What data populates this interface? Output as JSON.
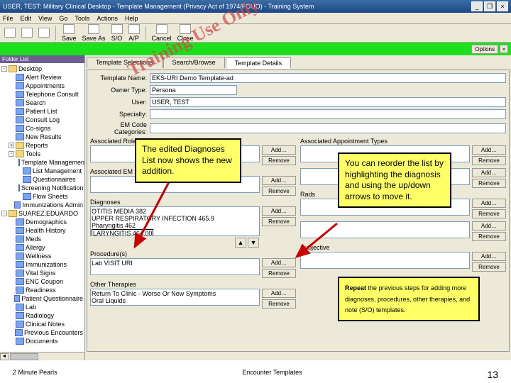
{
  "title": "USER, TEST: Military Clinical Desktop - Template Management (Privacy Act of 1974/FOUO) - Training System",
  "menu": [
    "File",
    "Edit",
    "View",
    "Go",
    "Tools",
    "Actions",
    "Help"
  ],
  "toolbar_btns": [
    {
      "ic": "new",
      "label": ""
    },
    {
      "ic": "open",
      "label": ""
    },
    {
      "ic": "save",
      "label": ""
    },
    {
      "ic": "sep"
    },
    {
      "ic": "save",
      "label": "Save"
    },
    {
      "ic": "saveas",
      "label": "Save As"
    },
    {
      "ic": "so",
      "label": "S/O"
    },
    {
      "ic": "ap",
      "label": "A/P"
    },
    {
      "ic": "sep"
    },
    {
      "ic": "cancel",
      "label": "Cancel"
    },
    {
      "ic": "close",
      "label": "Close"
    }
  ],
  "greenbar": {
    "options": "Options",
    "close": "×"
  },
  "sidebar": {
    "header": "Folder List",
    "nodes": [
      {
        "t": "Desktop",
        "tg": "-",
        "lvl": 0
      },
      {
        "t": "Alert Review",
        "tg": "",
        "lvl": 1,
        "ci": 1
      },
      {
        "t": "Appointments",
        "tg": "",
        "lvl": 1,
        "ci": 1
      },
      {
        "t": "Telephone Consult",
        "tg": "",
        "lvl": 1,
        "ci": 1
      },
      {
        "t": "Search",
        "tg": "",
        "lvl": 1,
        "ci": 1
      },
      {
        "t": "Patient List",
        "tg": "",
        "lvl": 1,
        "ci": 1
      },
      {
        "t": "Consult Log",
        "tg": "",
        "lvl": 1,
        "ci": 1
      },
      {
        "t": "Co-signs",
        "tg": "",
        "lvl": 1,
        "ci": 1
      },
      {
        "t": "New Results",
        "tg": "",
        "lvl": 1,
        "ci": 1
      },
      {
        "t": "Reports",
        "tg": "+",
        "lvl": 1
      },
      {
        "t": "Tools",
        "tg": "-",
        "lvl": 1
      },
      {
        "t": "Template Management",
        "tg": "",
        "lvl": 2,
        "ci": 1
      },
      {
        "t": "List Management",
        "tg": "",
        "lvl": 2,
        "ci": 1
      },
      {
        "t": "Questionnaires",
        "tg": "",
        "lvl": 2,
        "ci": 1
      },
      {
        "t": "Screening Notification",
        "tg": "",
        "lvl": 2,
        "ci": 1
      },
      {
        "t": "Flow Sheets",
        "tg": "",
        "lvl": 2,
        "ci": 1
      },
      {
        "t": "Immunizations Admin",
        "tg": "",
        "lvl": 1,
        "ci": 1
      },
      {
        "t": "SUAREZ,EDUARDO",
        "tg": "-",
        "lvl": 0
      },
      {
        "t": "Demographics",
        "tg": "",
        "lvl": 1,
        "ci": 1
      },
      {
        "t": "Health History",
        "tg": "",
        "lvl": 1,
        "ci": 1
      },
      {
        "t": "Meds",
        "tg": "",
        "lvl": 1,
        "ci": 1
      },
      {
        "t": "Allergy",
        "tg": "",
        "lvl": 1,
        "ci": 1
      },
      {
        "t": "Wellness",
        "tg": "",
        "lvl": 1,
        "ci": 1
      },
      {
        "t": "Immunizations",
        "tg": "",
        "lvl": 1,
        "ci": 1
      },
      {
        "t": "Vital Signs",
        "tg": "",
        "lvl": 1,
        "ci": 1
      },
      {
        "t": "ENC Coupon",
        "tg": "",
        "lvl": 1,
        "ci": 1
      },
      {
        "t": "Readiness",
        "tg": "",
        "lvl": 1,
        "ci": 1
      },
      {
        "t": "Patient Questionnaire",
        "tg": "",
        "lvl": 1,
        "ci": 1
      },
      {
        "t": "Lab",
        "tg": "",
        "lvl": 1,
        "ci": 1
      },
      {
        "t": "Radiology",
        "tg": "",
        "lvl": 1,
        "ci": 1
      },
      {
        "t": "Clinical Notes",
        "tg": "",
        "lvl": 1,
        "ci": 1
      },
      {
        "t": "Previous Encounters",
        "tg": "",
        "lvl": 1,
        "ci": 1
      },
      {
        "t": "Documents",
        "tg": "",
        "lvl": 1,
        "ci": 1
      }
    ]
  },
  "tabs": [
    "Template Selections",
    "Search/Browse",
    "Template Details"
  ],
  "active_tab": 2,
  "form": {
    "template_name_lbl": "Template Name:",
    "template_name": "EKS-URI Demo Template-ad",
    "owner_type_lbl": "Owner Type:",
    "owner_type": "Persona",
    "user_lbl": "User:",
    "user": "USER, TEST",
    "specialty_lbl": "Specialty:",
    "specialty": "",
    "em_lbl": "EM Code Categories:",
    "em": ""
  },
  "left_groups": [
    {
      "h": "Associated Roles",
      "items": [],
      "tall": 0
    },
    {
      "h": "Associated EM",
      "items": [],
      "tall": 0
    },
    {
      "h": "Diagnoses",
      "items": [
        "OTITIS MEDIA  382",
        "UPPER RESPIRATORY INFECTION  465.9",
        "Pharyngitis  462",
        "LARYNGITIS  464.00"
      ],
      "tall": 1,
      "arrows": 1,
      "hl": 3
    },
    {
      "h": "Procedure(s)",
      "items": [
        "Lab VISIT URI"
      ],
      "tall": 0
    },
    {
      "h": "Other Therapies",
      "items": [
        "Return To Clinic - Worse Or New Symptoms",
        "Oral Liquids"
      ],
      "tall": 0
    }
  ],
  "right_groups": [
    {
      "h": "Associated Appointment Types",
      "items": [],
      "tall": 0
    },
    {
      "h": "",
      "items": [],
      "tall": 0
    },
    {
      "h": "Rads",
      "items": [],
      "tall": 0
    },
    {
      "h": "",
      "items": [],
      "tall": 0
    },
    {
      "h": "Subjective",
      "items": [],
      "tall": 0
    }
  ],
  "btns": {
    "add": "Add…",
    "remove": "Remove"
  },
  "callouts": {
    "c1": "The edited Diagnoses List now shows the new addition.",
    "c2": "You can reorder the list by highlighting the diagnosis and using the up/down arrows to move it.",
    "c3_pre": "Repeat",
    "c3": " the previous steps for adding more diagnoses, procedures, other therapies, and note (S/O) templates."
  },
  "stamp": "Training Use Only",
  "footer": {
    "left": "2 Minute Pearls",
    "center": "Encounter Templates",
    "page": "13"
  }
}
